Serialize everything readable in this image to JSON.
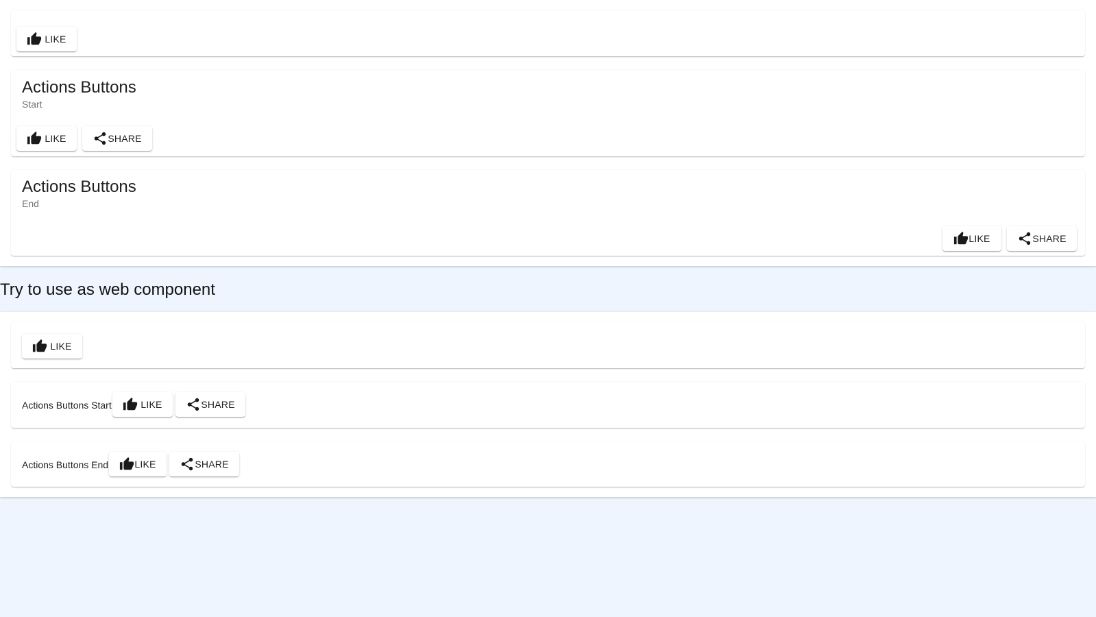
{
  "top_panel": {
    "card1": {
      "like_label": "LIKE"
    },
    "card2": {
      "title": "Actions Buttons",
      "subtitle": "Start",
      "like_label": "LIKE",
      "share_label": "SHARE"
    },
    "card3": {
      "title": "Actions Buttons",
      "subtitle": "End",
      "like_label": "LIKE",
      "share_label": "SHARE"
    }
  },
  "section_heading": "Try to use as web component",
  "web_panel": {
    "card1": {
      "like_label": "LIKE"
    },
    "card2": {
      "label": "Actions Buttons Start",
      "like_label": "LIKE",
      "share_label": "SHARE"
    },
    "card3": {
      "label": "Actions Buttons End",
      "like_label": "LIKE",
      "share_label": "SHARE"
    }
  },
  "icons": {
    "like": "thumb-up-icon",
    "share": "share-icon"
  },
  "colors": {
    "page_background": "#eef5fe",
    "card_background": "#ffffff",
    "subtitle": "#757575",
    "text": "#212121"
  }
}
